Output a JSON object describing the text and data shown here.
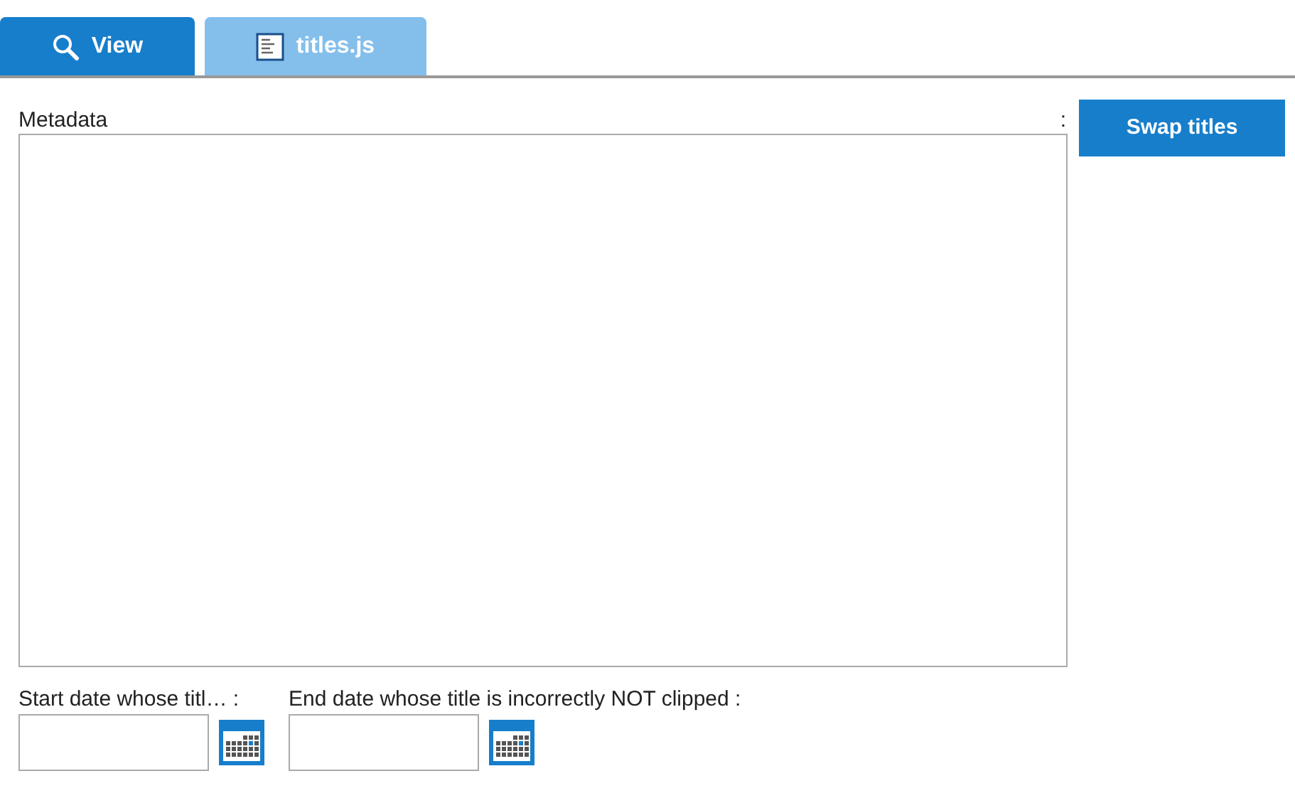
{
  "tabs": [
    {
      "label": "View",
      "kind": "search",
      "selected": true
    },
    {
      "label": "titles.js",
      "kind": "file",
      "selected": false
    }
  ],
  "metadata": {
    "label": "Metadata",
    "colon": ":"
  },
  "swap_button": "Swap titles",
  "date_fields": [
    {
      "label": "Start date whose titl…",
      "colon": ":"
    },
    {
      "label": "End date whose title is incorrectly NOT clipped",
      "colon": ":"
    }
  ]
}
